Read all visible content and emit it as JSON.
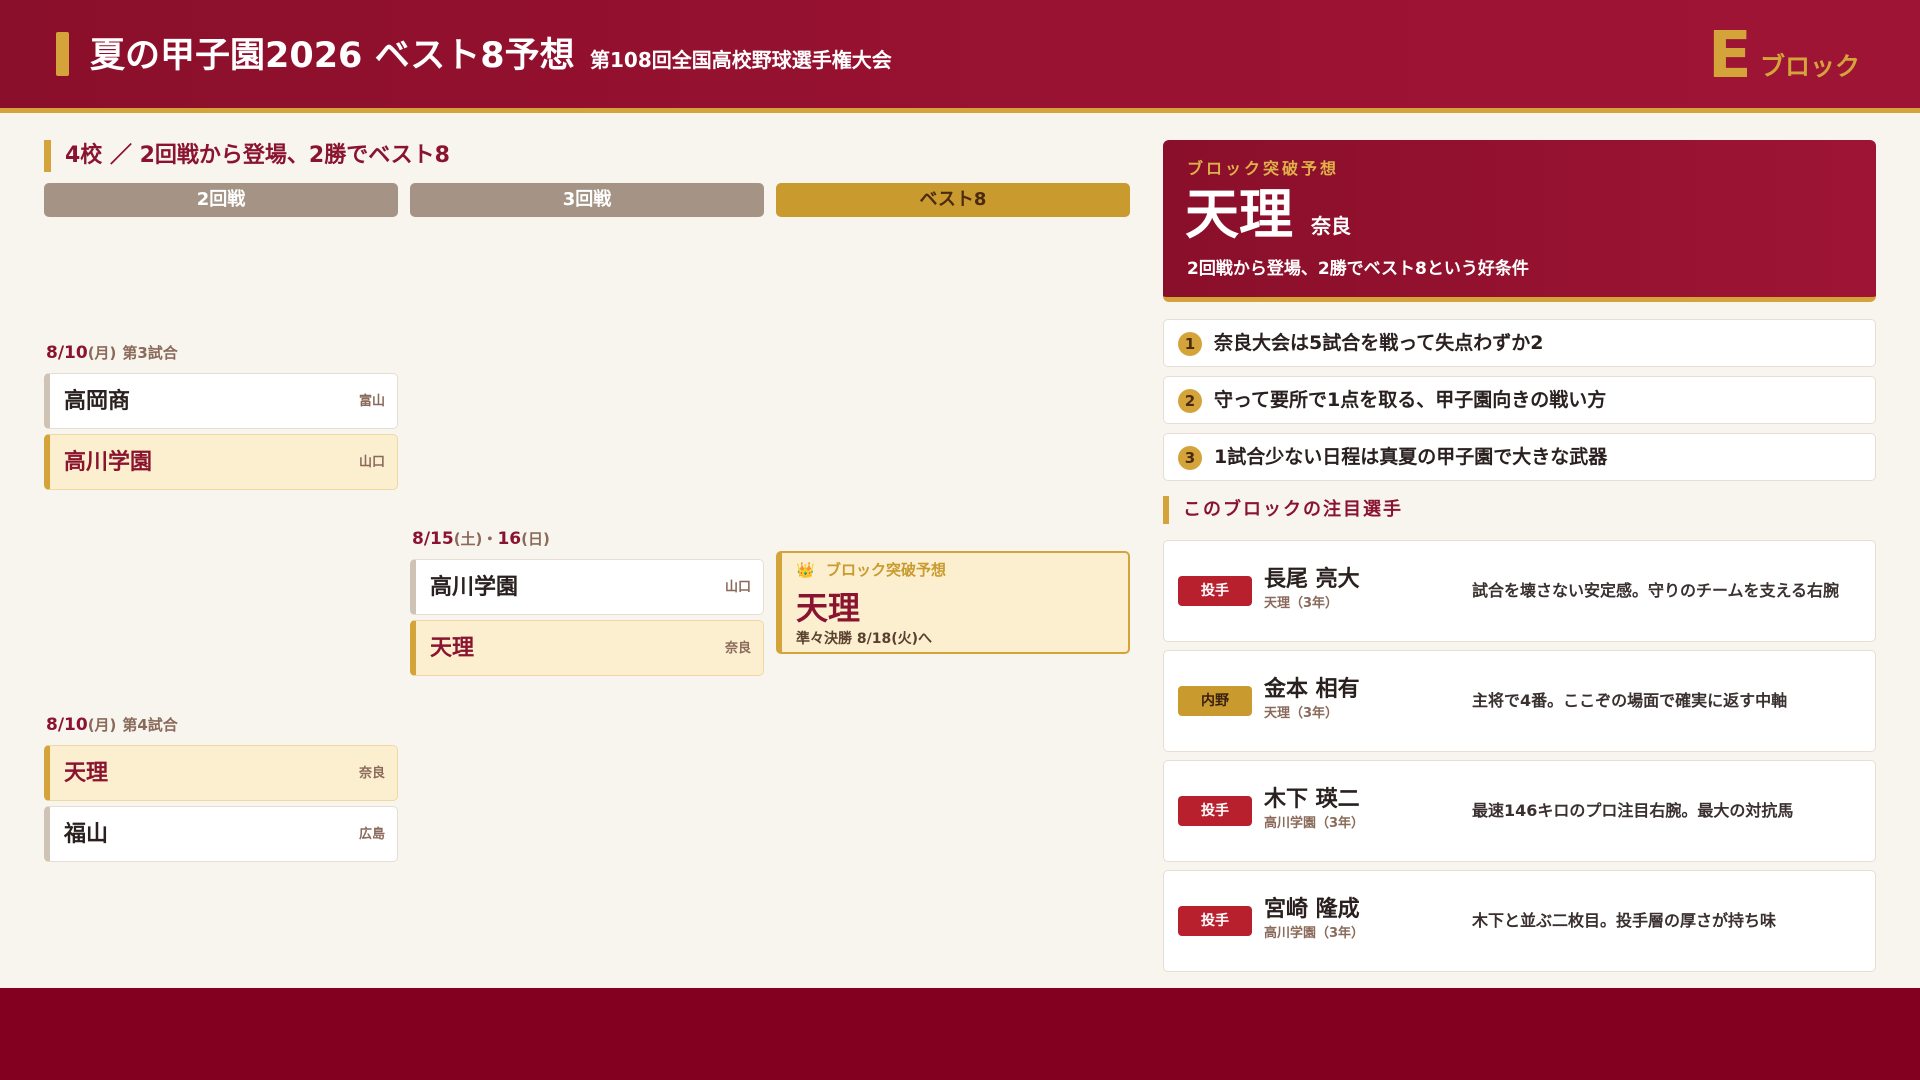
{
  "header": {
    "title": "夏の甲子園2026 ベスト8予想",
    "subtitle": "第108回全国高校野球選手権大会",
    "block_letter": "E",
    "block_word": "ブロック"
  },
  "bracket": {
    "section_title": "4校 ／ 2回戦から登場、2勝でベスト8",
    "rounds": [
      "2回戦",
      "3回戦",
      "ベスト8"
    ],
    "match1": {
      "date": "8/10",
      "weekday": "(月)",
      "game": "第3試合",
      "teams": [
        {
          "name": "高岡商",
          "pref": "富山"
        },
        {
          "name": "高川学園",
          "pref": "山口"
        }
      ]
    },
    "match2": {
      "date": "8/10",
      "weekday": "(月)",
      "game": "第4試合",
      "teams": [
        {
          "name": "天理",
          "pref": "奈良"
        },
        {
          "name": "福山",
          "pref": "広島"
        }
      ]
    },
    "match3": {
      "date": "8/15",
      "weekday1": "(土)",
      "sep": "・",
      "date2": "16",
      "weekday2": "(日)",
      "teams": [
        {
          "name": "高川学園",
          "pref": "山口"
        },
        {
          "name": "天理",
          "pref": "奈良"
        }
      ]
    },
    "prediction": {
      "crown": "👑",
      "label": "ブロック突破予想",
      "team": "天理",
      "next": "準々決勝 8/18(火)へ"
    }
  },
  "hero": {
    "label": "ブロック突破予想",
    "team": "天理",
    "pref": "奈良",
    "desc": "2回戦から登場、2勝でベスト8という好条件"
  },
  "points": [
    {
      "num": "1",
      "text": "奈良大会は5試合を戦って失点わずか2"
    },
    {
      "num": "2",
      "text": "守って要所で1点を取る、甲子園向きの戦い方"
    },
    {
      "num": "3",
      "text": "1試合少ない日程は真夏の甲子園で大きな武器"
    }
  ],
  "players_title": "このブロックの注目選手",
  "players": [
    {
      "pos": "投手",
      "name": "長尾 亮大",
      "school": "天理（3年）",
      "desc": "試合を壊さない安定感。守りのチームを支える右腕"
    },
    {
      "pos": "内野",
      "name": "金本 相有",
      "school": "天理（3年）",
      "desc": "主将で4番。ここぞの場面で確実に返す中軸"
    },
    {
      "pos": "投手",
      "name": "木下 瑛二",
      "school": "高川学園（3年）",
      "desc": "最速146キロのプロ注目右腕。最大の対抗馬"
    },
    {
      "pos": "投手",
      "name": "宮崎 隆成",
      "school": "高川学園（3年）",
      "desc": "木下と並ぶ二枚目。投手層の厚さが持ち味"
    }
  ]
}
